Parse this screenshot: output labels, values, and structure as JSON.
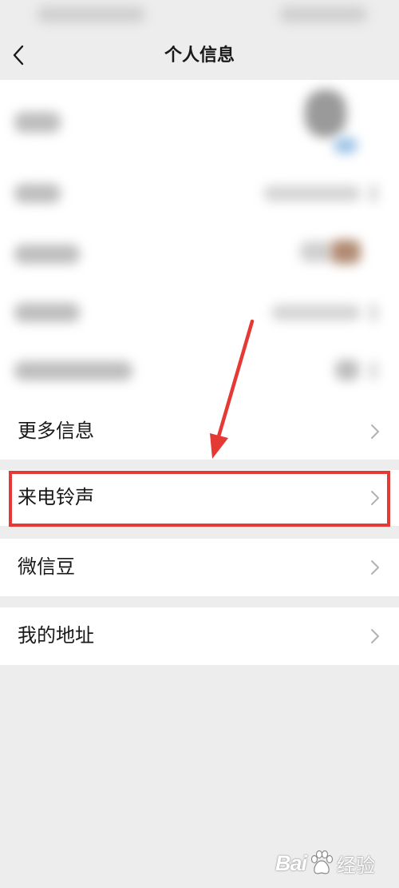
{
  "header": {
    "title": "个人信息"
  },
  "icons": {
    "back": "chevron-left-icon",
    "row_arrow": "chevron-right-icon",
    "watermark_logo": "paw-icon"
  },
  "menu": {
    "items": [
      {
        "label": "更多信息",
        "highlighted": false
      },
      {
        "label": "来电铃声",
        "highlighted": true
      },
      {
        "label": "微信豆",
        "highlighted": false
      },
      {
        "label": "我的地址",
        "highlighted": false
      }
    ]
  },
  "watermark": {
    "brand": "Bai",
    "suffix": "经验"
  },
  "colors": {
    "background": "#ededed",
    "row": "#ffffff",
    "text": "#191919",
    "chevron": "#b2b2b2",
    "annotation": "#e53935"
  }
}
